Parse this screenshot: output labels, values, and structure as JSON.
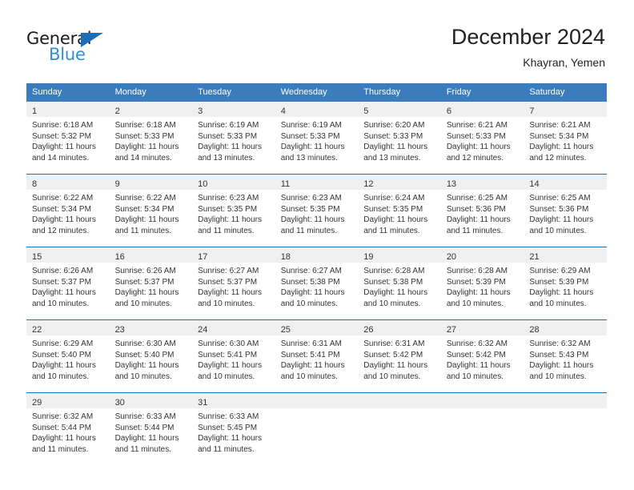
{
  "brand": {
    "name_top": "General",
    "name_bottom": "Blue",
    "triangle_color": "#1a6eb5",
    "blue_color": "#2d8fd5"
  },
  "header": {
    "title": "December 2024",
    "subtitle": "Khayran, Yemen"
  },
  "theme": {
    "header_bg": "#3a7cbe",
    "row_divider": "#1a6eb5",
    "daynum_bg": "#f0f0f0",
    "text": "#333333"
  },
  "weekdays": [
    "Sunday",
    "Monday",
    "Tuesday",
    "Wednesday",
    "Thursday",
    "Friday",
    "Saturday"
  ],
  "weeks": [
    [
      {
        "day": "1",
        "sunrise": "Sunrise: 6:18 AM",
        "sunset": "Sunset: 5:32 PM",
        "daylight1": "Daylight: 11 hours",
        "daylight2": "and 14 minutes."
      },
      {
        "day": "2",
        "sunrise": "Sunrise: 6:18 AM",
        "sunset": "Sunset: 5:33 PM",
        "daylight1": "Daylight: 11 hours",
        "daylight2": "and 14 minutes."
      },
      {
        "day": "3",
        "sunrise": "Sunrise: 6:19 AM",
        "sunset": "Sunset: 5:33 PM",
        "daylight1": "Daylight: 11 hours",
        "daylight2": "and 13 minutes."
      },
      {
        "day": "4",
        "sunrise": "Sunrise: 6:19 AM",
        "sunset": "Sunset: 5:33 PM",
        "daylight1": "Daylight: 11 hours",
        "daylight2": "and 13 minutes."
      },
      {
        "day": "5",
        "sunrise": "Sunrise: 6:20 AM",
        "sunset": "Sunset: 5:33 PM",
        "daylight1": "Daylight: 11 hours",
        "daylight2": "and 13 minutes."
      },
      {
        "day": "6",
        "sunrise": "Sunrise: 6:21 AM",
        "sunset": "Sunset: 5:33 PM",
        "daylight1": "Daylight: 11 hours",
        "daylight2": "and 12 minutes."
      },
      {
        "day": "7",
        "sunrise": "Sunrise: 6:21 AM",
        "sunset": "Sunset: 5:34 PM",
        "daylight1": "Daylight: 11 hours",
        "daylight2": "and 12 minutes."
      }
    ],
    [
      {
        "day": "8",
        "sunrise": "Sunrise: 6:22 AM",
        "sunset": "Sunset: 5:34 PM",
        "daylight1": "Daylight: 11 hours",
        "daylight2": "and 12 minutes."
      },
      {
        "day": "9",
        "sunrise": "Sunrise: 6:22 AM",
        "sunset": "Sunset: 5:34 PM",
        "daylight1": "Daylight: 11 hours",
        "daylight2": "and 11 minutes."
      },
      {
        "day": "10",
        "sunrise": "Sunrise: 6:23 AM",
        "sunset": "Sunset: 5:35 PM",
        "daylight1": "Daylight: 11 hours",
        "daylight2": "and 11 minutes."
      },
      {
        "day": "11",
        "sunrise": "Sunrise: 6:23 AM",
        "sunset": "Sunset: 5:35 PM",
        "daylight1": "Daylight: 11 hours",
        "daylight2": "and 11 minutes."
      },
      {
        "day": "12",
        "sunrise": "Sunrise: 6:24 AM",
        "sunset": "Sunset: 5:35 PM",
        "daylight1": "Daylight: 11 hours",
        "daylight2": "and 11 minutes."
      },
      {
        "day": "13",
        "sunrise": "Sunrise: 6:25 AM",
        "sunset": "Sunset: 5:36 PM",
        "daylight1": "Daylight: 11 hours",
        "daylight2": "and 11 minutes."
      },
      {
        "day": "14",
        "sunrise": "Sunrise: 6:25 AM",
        "sunset": "Sunset: 5:36 PM",
        "daylight1": "Daylight: 11 hours",
        "daylight2": "and 10 minutes."
      }
    ],
    [
      {
        "day": "15",
        "sunrise": "Sunrise: 6:26 AM",
        "sunset": "Sunset: 5:37 PM",
        "daylight1": "Daylight: 11 hours",
        "daylight2": "and 10 minutes."
      },
      {
        "day": "16",
        "sunrise": "Sunrise: 6:26 AM",
        "sunset": "Sunset: 5:37 PM",
        "daylight1": "Daylight: 11 hours",
        "daylight2": "and 10 minutes."
      },
      {
        "day": "17",
        "sunrise": "Sunrise: 6:27 AM",
        "sunset": "Sunset: 5:37 PM",
        "daylight1": "Daylight: 11 hours",
        "daylight2": "and 10 minutes."
      },
      {
        "day": "18",
        "sunrise": "Sunrise: 6:27 AM",
        "sunset": "Sunset: 5:38 PM",
        "daylight1": "Daylight: 11 hours",
        "daylight2": "and 10 minutes."
      },
      {
        "day": "19",
        "sunrise": "Sunrise: 6:28 AM",
        "sunset": "Sunset: 5:38 PM",
        "daylight1": "Daylight: 11 hours",
        "daylight2": "and 10 minutes."
      },
      {
        "day": "20",
        "sunrise": "Sunrise: 6:28 AM",
        "sunset": "Sunset: 5:39 PM",
        "daylight1": "Daylight: 11 hours",
        "daylight2": "and 10 minutes."
      },
      {
        "day": "21",
        "sunrise": "Sunrise: 6:29 AM",
        "sunset": "Sunset: 5:39 PM",
        "daylight1": "Daylight: 11 hours",
        "daylight2": "and 10 minutes."
      }
    ],
    [
      {
        "day": "22",
        "sunrise": "Sunrise: 6:29 AM",
        "sunset": "Sunset: 5:40 PM",
        "daylight1": "Daylight: 11 hours",
        "daylight2": "and 10 minutes."
      },
      {
        "day": "23",
        "sunrise": "Sunrise: 6:30 AM",
        "sunset": "Sunset: 5:40 PM",
        "daylight1": "Daylight: 11 hours",
        "daylight2": "and 10 minutes."
      },
      {
        "day": "24",
        "sunrise": "Sunrise: 6:30 AM",
        "sunset": "Sunset: 5:41 PM",
        "daylight1": "Daylight: 11 hours",
        "daylight2": "and 10 minutes."
      },
      {
        "day": "25",
        "sunrise": "Sunrise: 6:31 AM",
        "sunset": "Sunset: 5:41 PM",
        "daylight1": "Daylight: 11 hours",
        "daylight2": "and 10 minutes."
      },
      {
        "day": "26",
        "sunrise": "Sunrise: 6:31 AM",
        "sunset": "Sunset: 5:42 PM",
        "daylight1": "Daylight: 11 hours",
        "daylight2": "and 10 minutes."
      },
      {
        "day": "27",
        "sunrise": "Sunrise: 6:32 AM",
        "sunset": "Sunset: 5:42 PM",
        "daylight1": "Daylight: 11 hours",
        "daylight2": "and 10 minutes."
      },
      {
        "day": "28",
        "sunrise": "Sunrise: 6:32 AM",
        "sunset": "Sunset: 5:43 PM",
        "daylight1": "Daylight: 11 hours",
        "daylight2": "and 10 minutes."
      }
    ],
    [
      {
        "day": "29",
        "sunrise": "Sunrise: 6:32 AM",
        "sunset": "Sunset: 5:44 PM",
        "daylight1": "Daylight: 11 hours",
        "daylight2": "and 11 minutes."
      },
      {
        "day": "30",
        "sunrise": "Sunrise: 6:33 AM",
        "sunset": "Sunset: 5:44 PM",
        "daylight1": "Daylight: 11 hours",
        "daylight2": "and 11 minutes."
      },
      {
        "day": "31",
        "sunrise": "Sunrise: 6:33 AM",
        "sunset": "Sunset: 5:45 PM",
        "daylight1": "Daylight: 11 hours",
        "daylight2": "and 11 minutes."
      },
      {
        "day": "",
        "sunrise": "",
        "sunset": "",
        "daylight1": "",
        "daylight2": ""
      },
      {
        "day": "",
        "sunrise": "",
        "sunset": "",
        "daylight1": "",
        "daylight2": ""
      },
      {
        "day": "",
        "sunrise": "",
        "sunset": "",
        "daylight1": "",
        "daylight2": ""
      },
      {
        "day": "",
        "sunrise": "",
        "sunset": "",
        "daylight1": "",
        "daylight2": ""
      }
    ]
  ]
}
